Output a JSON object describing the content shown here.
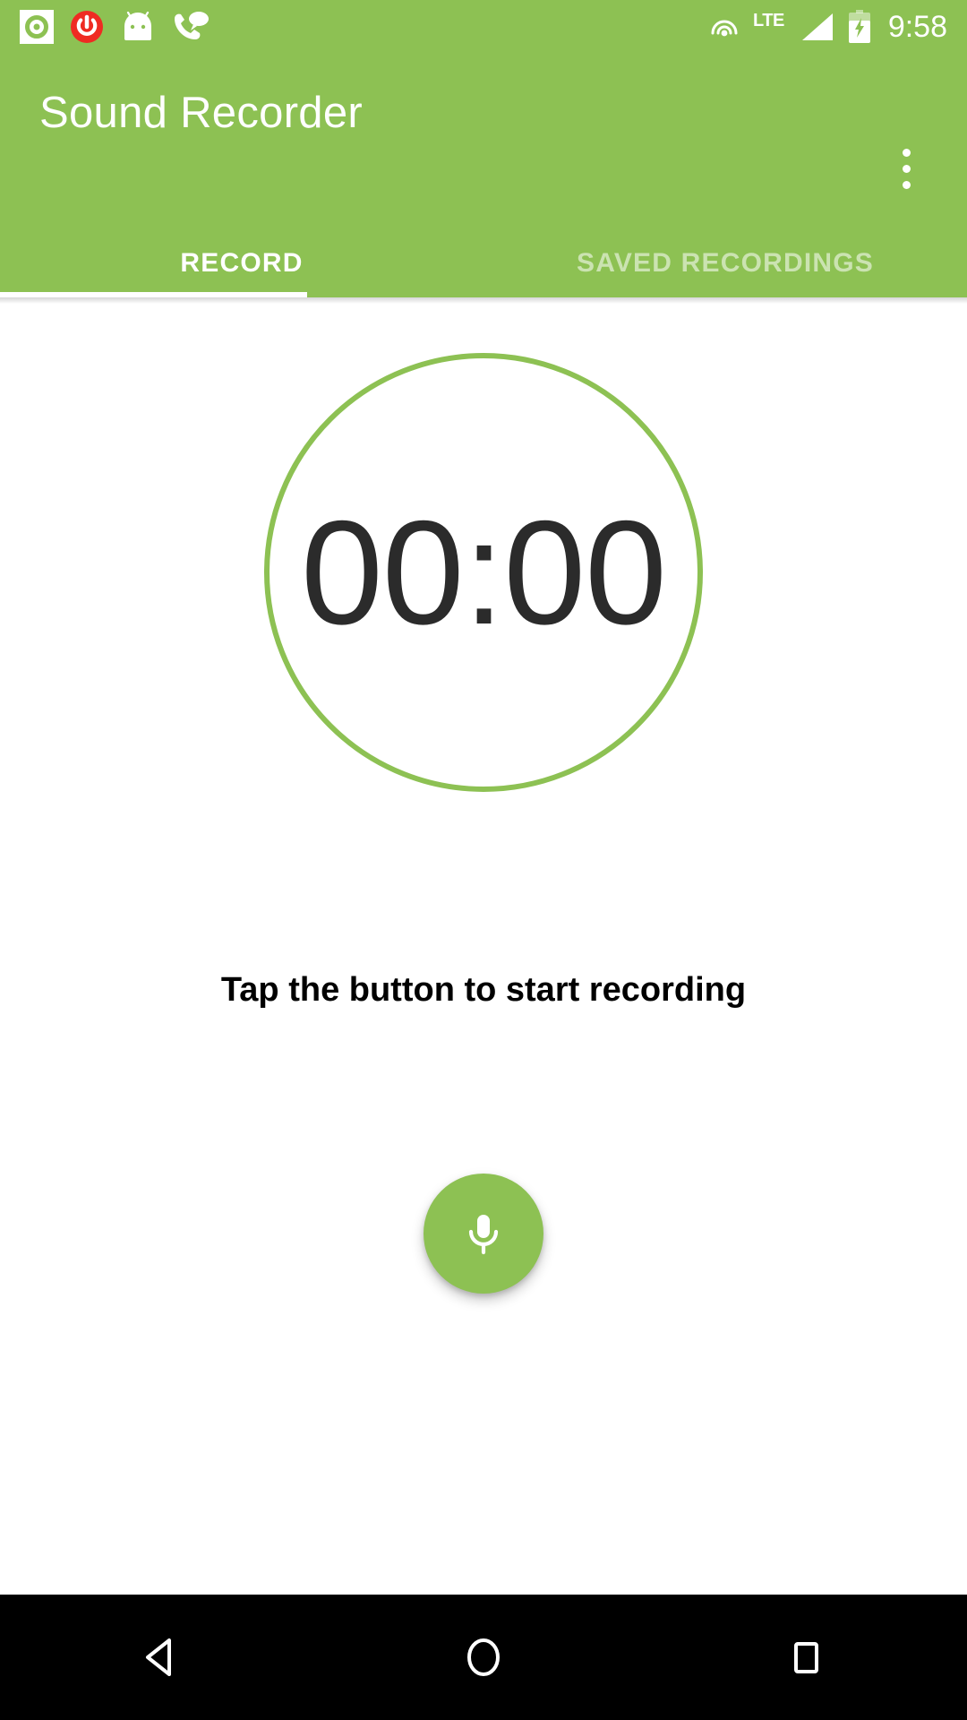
{
  "statusbar": {
    "icons_left": [
      {
        "name": "sound-recorder-notification-icon",
        "label": "recorder"
      },
      {
        "name": "power-off-icon",
        "label": "power"
      },
      {
        "name": "android-head-icon",
        "label": "android"
      },
      {
        "name": "call-message-icon",
        "label": "call"
      }
    ],
    "icons_right": [
      {
        "name": "cast-icon",
        "label": "cast"
      },
      {
        "name": "signal-icon",
        "label": "LTE signal"
      },
      {
        "name": "battery-charging-icon",
        "label": "battery charging"
      }
    ],
    "network_label": "LTE",
    "clock": "9:58"
  },
  "appbar": {
    "title": "Sound Recorder",
    "overflow_label": "More options",
    "background_color": "#8dc153"
  },
  "tabs": {
    "items": [
      {
        "label": "RECORD",
        "active": true
      },
      {
        "label": "SAVED RECORDINGS",
        "active": false
      }
    ],
    "indicator_color": "#ffffff"
  },
  "main": {
    "timer": "00:00",
    "timer_ring_color": "#8dc153",
    "timer_text_color": "#2b2b2b",
    "hint": "Tap the button to start recording",
    "record_button": {
      "icon": "microphone-icon",
      "label": "Record",
      "color": "#8dc153"
    }
  },
  "navbar": {
    "buttons": [
      {
        "name": "back",
        "label": "Back"
      },
      {
        "name": "home",
        "label": "Home"
      },
      {
        "name": "recents",
        "label": "Recent apps"
      }
    ]
  }
}
